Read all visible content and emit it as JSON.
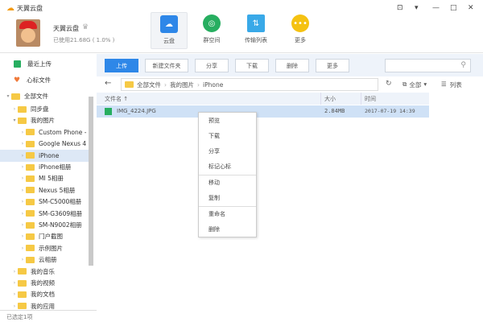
{
  "app": {
    "name": "天翼云盘",
    "user": "天翼云盘",
    "quota": "已使用21.68G ( 1.0% )"
  },
  "nav": [
    {
      "label": "云盘",
      "color": "#2e87e8",
      "icon": "cloud-icon"
    },
    {
      "label": "群空间",
      "color": "#27ae60",
      "icon": "group-icon"
    },
    {
      "label": "传输列表",
      "color": "#39a9e8",
      "icon": "transfer-icon"
    },
    {
      "label": "更多",
      "color": "#f5c212",
      "icon": "more-icon"
    }
  ],
  "window": {
    "controls": [
      "⊡",
      "▾",
      "—",
      "□",
      "✕"
    ]
  },
  "sidebar": {
    "recent": "最近上传",
    "starred": "心标文件",
    "all": "全部文件",
    "items": [
      "同步盘",
      "我的图片",
      "Custom Phone -",
      "Google Nexus 4",
      "iPhone",
      "iPhone相册",
      "MI 5相册",
      "Nexus 5相册",
      "SM-C5000相册",
      "SM-G3609相册",
      "SM-N9002相册",
      "门户截图",
      "示例图片",
      "云相册",
      "我的音乐",
      "我的视频",
      "我的文档",
      "我的应用"
    ],
    "status": "已选定1项"
  },
  "toolbar": {
    "upload": "上传",
    "new_folder": "新建文件夹",
    "share": "分享",
    "download": "下载",
    "delete": "删除",
    "more": "更多",
    "search_placeholder": ""
  },
  "breadcrumb": [
    "全部文件",
    "我的图片",
    "iPhone"
  ],
  "view": {
    "filter": "全部",
    "list": "列表"
  },
  "table": {
    "headers": {
      "name": "文件名 ↑",
      "size": "大小",
      "time": "时间"
    },
    "rows": [
      {
        "name": "IMG_4224.JPG",
        "size": "2.84MB",
        "time": "2017-07-19 14:39"
      }
    ]
  },
  "context_menu": [
    "预览",
    "下载",
    "分享",
    "标记心标",
    "移动",
    "复制",
    "重命名",
    "删除"
  ]
}
